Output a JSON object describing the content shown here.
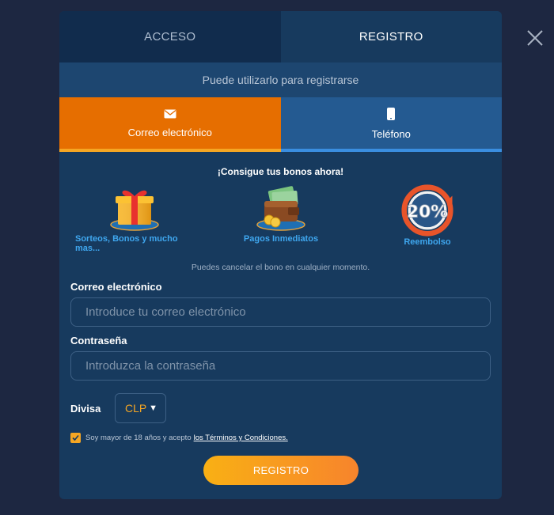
{
  "tabs": {
    "login": "ACCESO",
    "register": "REGISTRO"
  },
  "subtitle": "Puede utilizarlo para registrarse",
  "methods": {
    "email": "Correo electrónico",
    "phone": "Teléfono"
  },
  "promo": {
    "title": "¡Consigue tus bonos ahora!",
    "items": [
      {
        "label": "Sorteos, Bonos y mucho mas..."
      },
      {
        "label": "Pagos Inmediatos"
      },
      {
        "label": "Reembolso",
        "badge": "20%"
      }
    ],
    "note": "Puedes cancelar el bono en cualquier momento."
  },
  "form": {
    "email_label": "Correo electrónico",
    "email_placeholder": "Introduce tu correo electrónico",
    "password_label": "Contraseña",
    "password_placeholder": "Introduzca la contraseña",
    "currency_label": "Divisa",
    "currency_value": "CLP",
    "terms_text": "Soy mayor de 18 años y acepto",
    "terms_link": "los Términos y Condiciones.",
    "terms_checked": true,
    "submit": "REGISTRO"
  },
  "colors": {
    "accent": "#e66e00",
    "link": "#3fa7ef",
    "background": "#1d2741"
  }
}
